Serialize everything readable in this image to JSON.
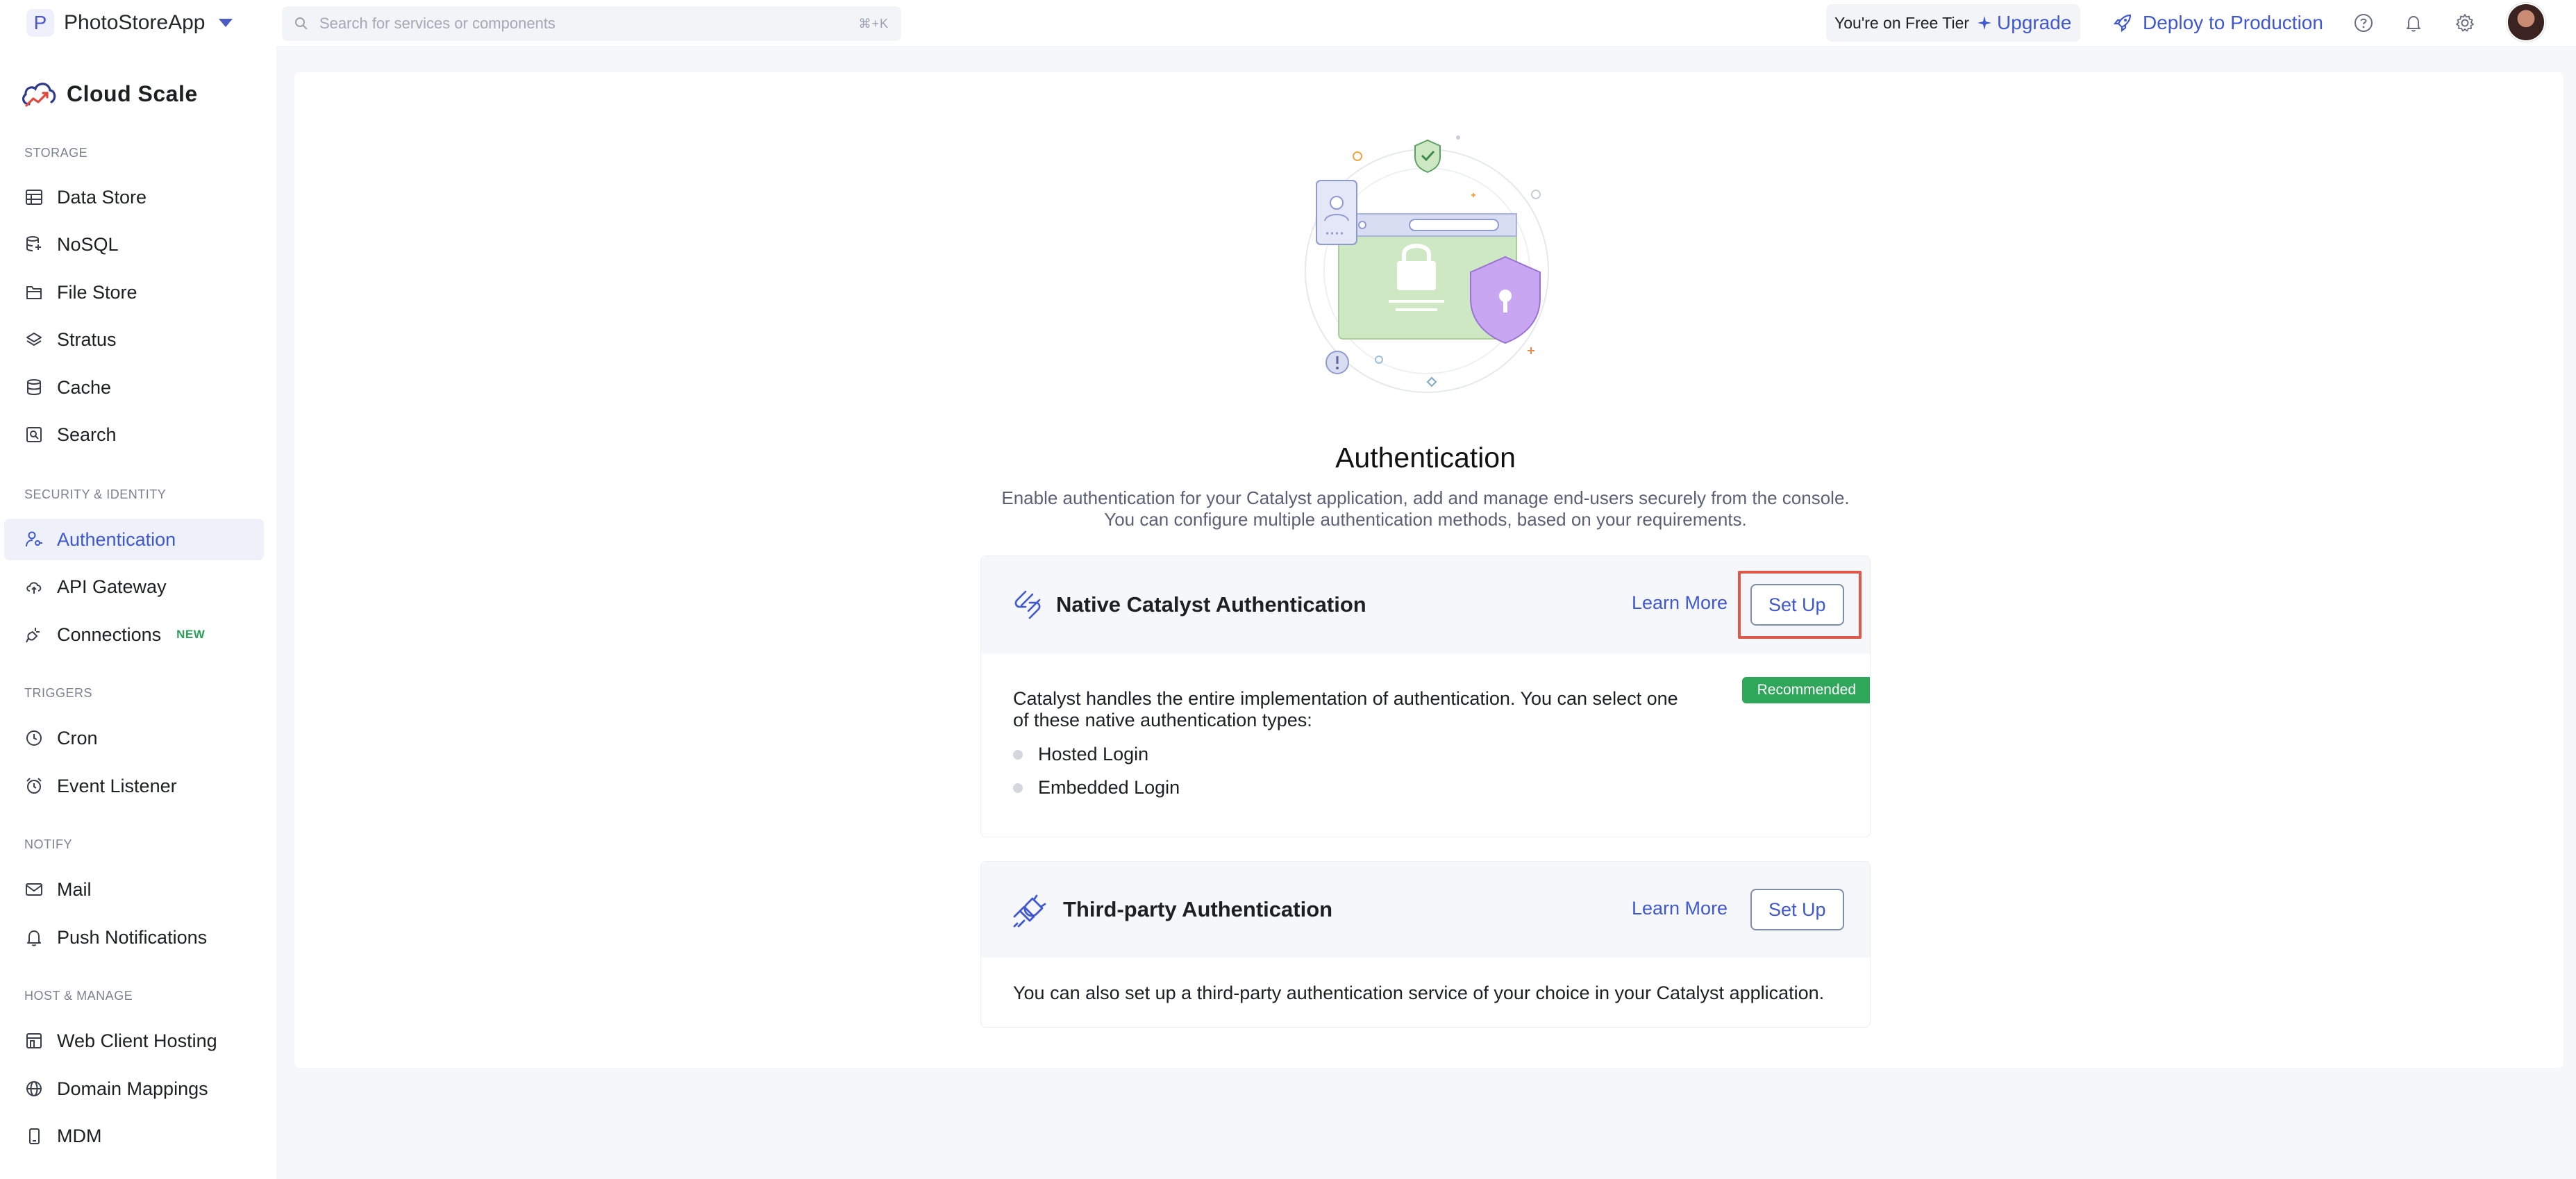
{
  "topbar": {
    "app_badge": "P",
    "app_name": "PhotoStoreApp",
    "search_placeholder": "Search for services or components",
    "search_shortcut": "⌘+K",
    "tier_text": "You're on Free Tier",
    "upgrade_label": "Upgrade",
    "deploy_label": "Deploy to Production"
  },
  "sidebar": {
    "brand": "Cloud Scale",
    "sections": {
      "storage": "STORAGE",
      "security": "SECURITY & IDENTITY",
      "triggers": "TRIGGERS",
      "notify": "NOTIFY",
      "host": "HOST & MANAGE"
    },
    "items": {
      "data_store": "Data Store",
      "nosql": "NoSQL",
      "file_store": "File Store",
      "stratus": "Stratus",
      "cache": "Cache",
      "search": "Search",
      "authentication": "Authentication",
      "api_gateway": "API Gateway",
      "connections": "Connections",
      "connections_badge": "NEW",
      "cron": "Cron",
      "event_listener": "Event Listener",
      "mail": "Mail",
      "push_notifications": "Push Notifications",
      "web_client_hosting": "Web Client Hosting",
      "domain_mappings": "Domain Mappings",
      "mdm": "MDM"
    }
  },
  "main": {
    "title": "Authentication",
    "description_line1": "Enable authentication for your Catalyst application, add and manage end-users securely from the console.",
    "description_line2": "You can configure multiple authentication methods, based on your requirements.",
    "native": {
      "title": "Native Catalyst Authentication",
      "learn_more": "Learn More",
      "setup": "Set Up",
      "badge": "Recommended",
      "description": "Catalyst handles the entire implementation of authentication. You can select one of these native authentication types:",
      "options": [
        "Hosted Login",
        "Embedded Login"
      ]
    },
    "third_party": {
      "title": "Third-party Authentication",
      "learn_more": "Learn More",
      "setup": "Set Up",
      "description": "You can also set up a third-party authentication service of your choice in your Catalyst application."
    }
  },
  "colors": {
    "accent": "#3f58d0",
    "highlight": "#dd5a4a",
    "recommended": "#2ea75a"
  }
}
